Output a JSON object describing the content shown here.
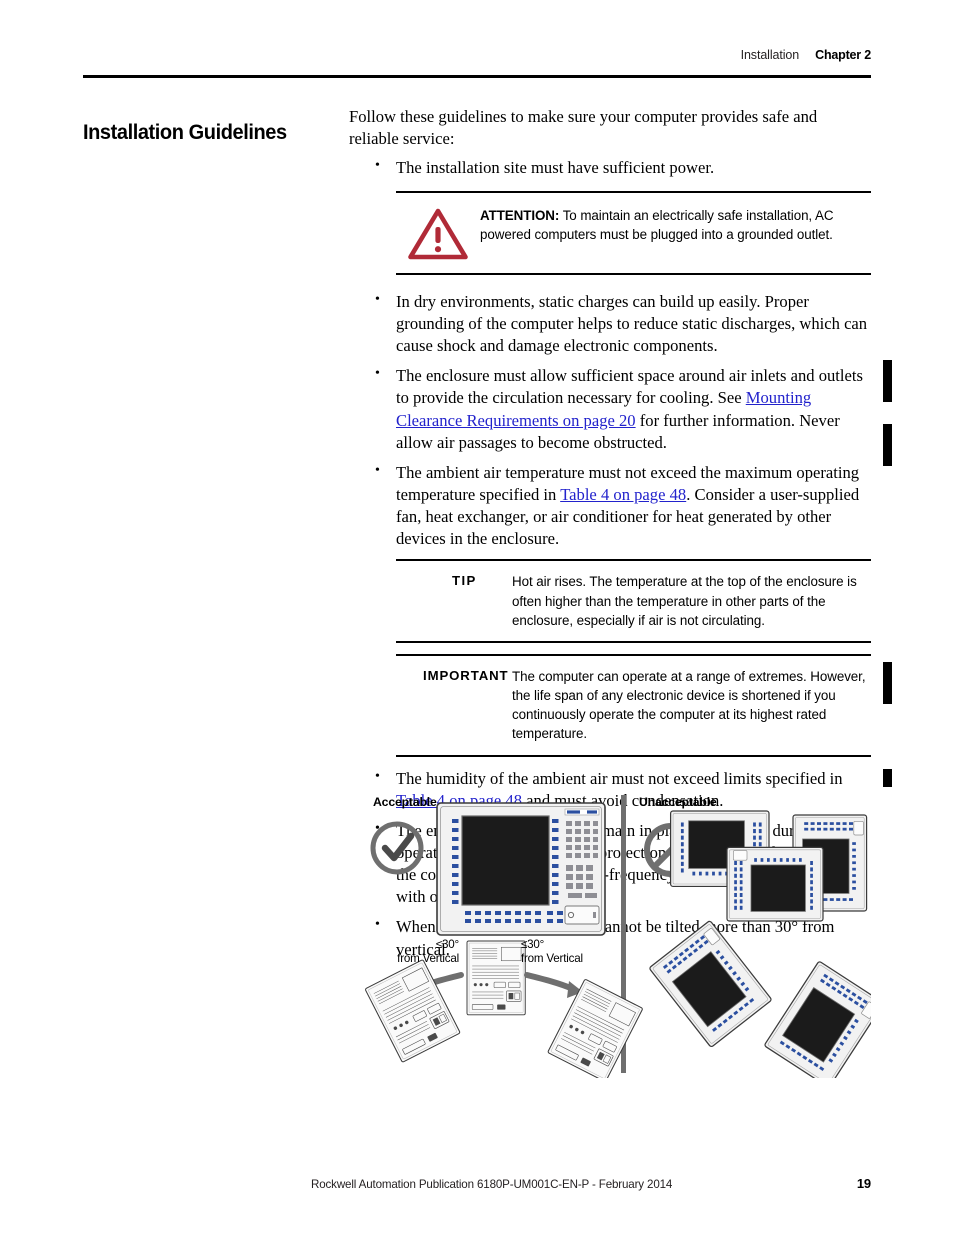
{
  "header": {
    "section": "Installation",
    "chapter": "Chapter 2"
  },
  "heading": "Installation Guidelines",
  "intro": "Follow these guidelines to make sure your computer provides safe and reliable service:",
  "bullets": {
    "power": "The installation site must have sufficient power.",
    "static": "In dry environments, static charges can build up easily. Proper grounding of the computer helps to reduce static discharges, which can cause shock and damage electronic components.",
    "enclosure_space_pre": "The enclosure must allow sufficient space around air inlets and outlets to provide the circulation necessary for cooling. See ",
    "enclosure_space_link": "Mounting Clearance Requirements on page 20",
    "enclosure_space_post": " for further information. Never allow air passages to become obstructed.",
    "ambient_pre": "The ambient air temperature must not exceed the maximum operating temperature specified in ",
    "ambient_link": "Table 4 on page 48",
    "ambient_post": ". Consider a user-supplied fan, heat exchanger, or air conditioner for heat generated by other devices in the enclosure.",
    "humidity_pre": "The humidity of the ambient air must not exceed limits specified in ",
    "humidity_link": "Table 4 on page 48",
    "humidity_post": " and must avoid condensation.",
    "cover": "The enclosure or cover must remain in place at all times during operation. The cover provides protection against high voltages inside the computer and inhibits radio-frequency emissions that can interfere with other equipment.",
    "tilt": "When mounted, the computer cannot be tilted more than 30° from vertical."
  },
  "attention": {
    "label": "ATTENTION:",
    "text": " To maintain an electrically safe installation, AC powered computers must be plugged into a grounded outlet.",
    "icon": "warning-triangle-icon",
    "color": "#b02a37"
  },
  "tip": {
    "label": "TIP",
    "text": "Hot air rises. The temperature at the top of the enclosure is often higher than the temperature in other parts of the enclosure, especially if air is not circulating."
  },
  "important": {
    "label": "IMPORTANT",
    "text": "The computer can operate at a range of extremes. However, the life span of any electronic device is shortened if you continuously operate the computer at its highest rated temperature."
  },
  "figure": {
    "acceptable_label": "Acceptable",
    "unacceptable_label": "Unacceptable",
    "acceptable_icon": "check-circle-icon",
    "unacceptable_icon": "no-entry-circle-icon",
    "tilt_left_line1": "≤30°",
    "tilt_left_line2": "from Vertical",
    "tilt_right_line1": "≤30°",
    "tilt_right_line2": "from Vertical"
  },
  "footer": {
    "publication": "Rockwell Automation Publication 6180P-UM001C-EN-P - February 2014",
    "page": "19"
  }
}
